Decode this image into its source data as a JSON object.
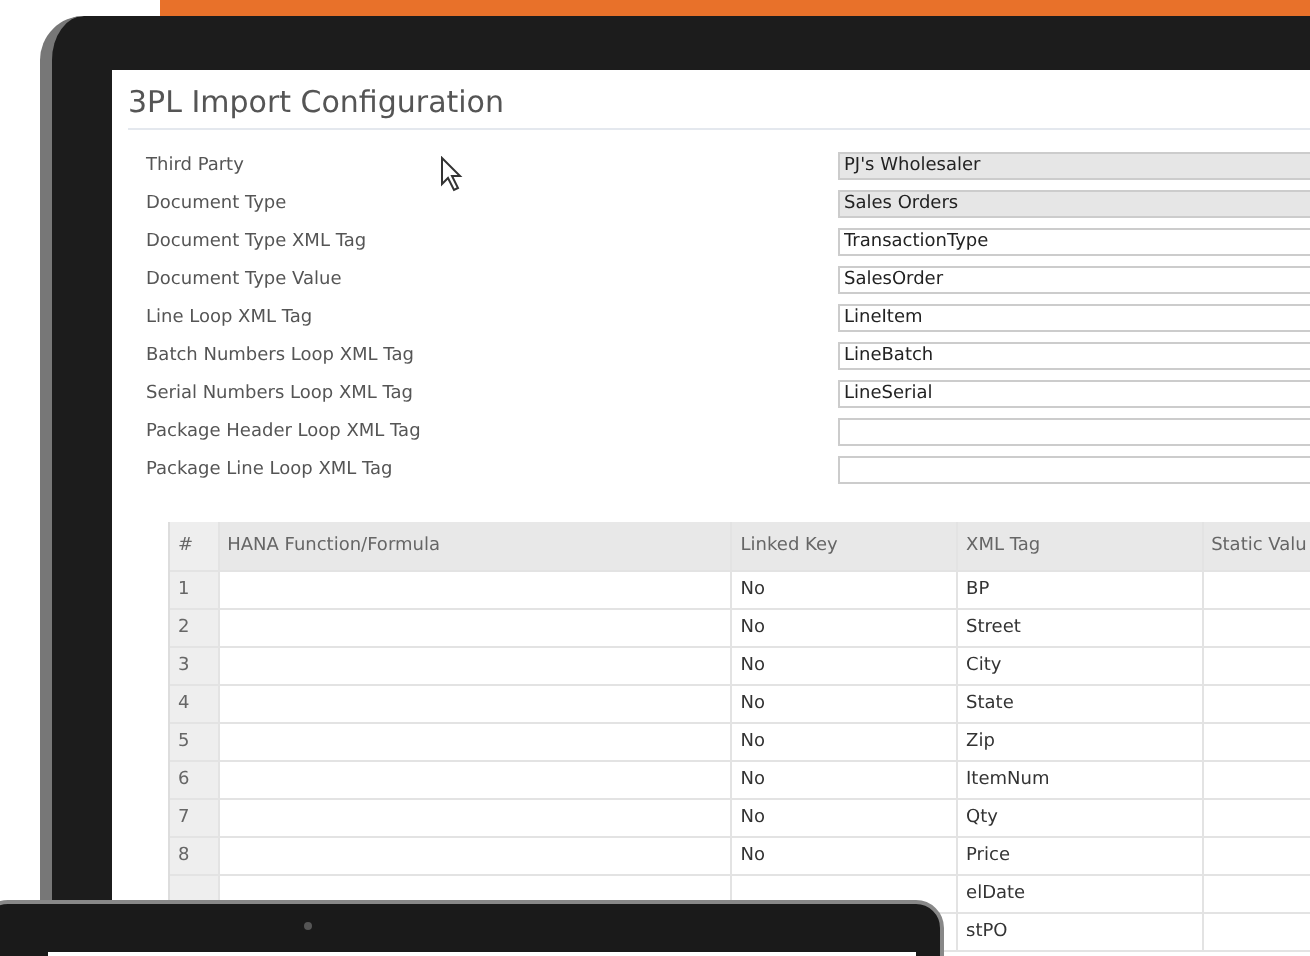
{
  "window": {
    "title": "3PL Import Configuration"
  },
  "fields": [
    {
      "label": "Third Party",
      "value": "PJ's Wholesaler",
      "readonly": true
    },
    {
      "label": "Document Type",
      "value": "Sales Orders",
      "readonly": true
    },
    {
      "label": "Document Type XML Tag",
      "value": "TransactionType",
      "readonly": false
    },
    {
      "label": "Document Type Value",
      "value": "SalesOrder",
      "readonly": false
    },
    {
      "label": "Line Loop XML Tag",
      "value": "LineItem",
      "readonly": false
    },
    {
      "label": "Batch Numbers Loop XML Tag",
      "value": "LineBatch",
      "readonly": false
    },
    {
      "label": "Serial Numbers Loop XML Tag",
      "value": "LineSerial",
      "readonly": false
    },
    {
      "label": "Package Header Loop XML Tag",
      "readonly": false
    },
    {
      "label": "Package Line Loop XML Tag",
      "readonly": false
    }
  ],
  "table": {
    "columns": [
      "#",
      "HANA Function/Formula",
      "Linked Key",
      "XML Tag",
      "Static Valu"
    ],
    "rows": [
      {
        "number": "1",
        "linked_key": "No",
        "xml_tag": "BP"
      },
      {
        "number": "2",
        "linked_key": "No",
        "xml_tag": "Street"
      },
      {
        "number": "3",
        "linked_key": "No",
        "xml_tag": "City"
      },
      {
        "number": "4",
        "linked_key": "No",
        "xml_tag": "State"
      },
      {
        "number": "5",
        "linked_key": "No",
        "xml_tag": "Zip"
      },
      {
        "number": "6",
        "linked_key": "No",
        "xml_tag": "ItemNum"
      },
      {
        "number": "7",
        "linked_key": "No",
        "xml_tag": "Qty"
      },
      {
        "number": "8",
        "linked_key": "No",
        "xml_tag": "Price"
      },
      {
        "xml_tag": "elDate"
      },
      {
        "xml_tag": "stPO"
      }
    ]
  }
}
